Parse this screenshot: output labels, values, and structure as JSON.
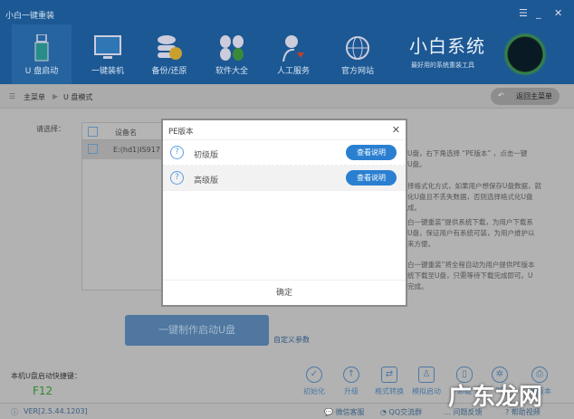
{
  "app": {
    "title": "小白一键重装",
    "brand": "小白系统",
    "slogan": "最好用的系统重装工具"
  },
  "nav": [
    {
      "label": "U 盘启动",
      "icon": "usb-icon"
    },
    {
      "label": "一键装机",
      "icon": "monitor-icon"
    },
    {
      "label": "备份/还原",
      "icon": "database-icon"
    },
    {
      "label": "软件大全",
      "icon": "apps-icon"
    },
    {
      "label": "人工服务",
      "icon": "user-heart-icon"
    },
    {
      "label": "官方网站",
      "icon": "globe-icon"
    }
  ],
  "breadcrumb": {
    "root": "主菜单",
    "current": "U 盘模式",
    "back": "返回主菜单"
  },
  "select_label": "请选择：",
  "table": {
    "header": "设备名",
    "rows": [
      "E:(hd1)IS917 I"
    ]
  },
  "info": [
    "U盘，右下角选择 “PE版本” ，点击一键",
    "U盘。",
    "择格式化方式，如果用户想保存U盘数据，就",
    "化U盘且不丢失数据，否则选择格式化U盘",
    "成。",
    "白一键重装”提供系统下载，为用户下载系",
    "U盘，保证用户有系统可装，为用户维护以",
    "来方便。",
    "白一键重装”将全程自动为用户提供PE版本",
    "统下载至U盘，只需等待下载完成即可。U",
    "完成。"
  ],
  "make_button": "一键制作启动U盘",
  "custom_params": "自定义参数",
  "hotkey": {
    "label": "本机U盘启动快捷键：",
    "key": "F12"
  },
  "tools": [
    {
      "label": "初始化",
      "icon": "check-circle-icon"
    },
    {
      "label": "升级",
      "icon": "upload-icon"
    },
    {
      "label": "格式转换",
      "icon": "convert-icon"
    },
    {
      "label": "模拟启动",
      "icon": "stamp-icon"
    },
    {
      "label": "卸载",
      "icon": "mouse-icon"
    },
    {
      "label": "PE",
      "icon": "gear-icon"
    },
    {
      "label": "PE版本",
      "icon": "printer-icon"
    }
  ],
  "footer": {
    "version": "VER[2.5.44.1203]",
    "links": [
      "微信客服",
      "QQ交流群",
      "问题反馈",
      "帮助视频"
    ]
  },
  "dialog": {
    "title": "PE版本",
    "options": [
      {
        "label": "初级版",
        "button": "查看说明"
      },
      {
        "label": "高级版",
        "button": "查看说明"
      }
    ],
    "confirm": "确定"
  },
  "watermark": "广东龙网"
}
